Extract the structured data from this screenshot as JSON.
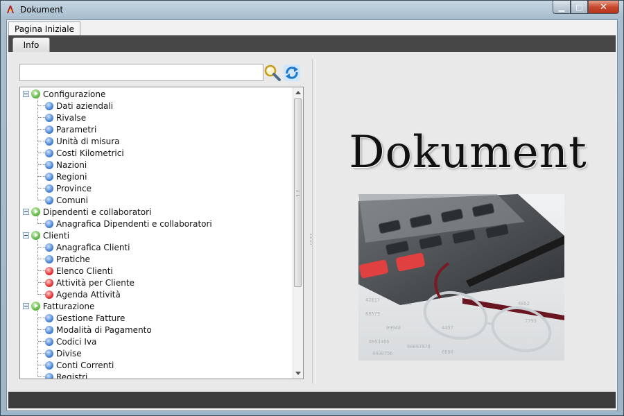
{
  "window": {
    "title": "Dokument",
    "buttons": {
      "minimize": "▁",
      "maximize": "□",
      "close": "✕"
    }
  },
  "tabs": {
    "top_tab": "Pagina Iniziale",
    "sub_tab": "Info"
  },
  "search": {
    "value": "",
    "placeholder": ""
  },
  "tree": {
    "groups": [
      {
        "label": "Configurazione",
        "items": [
          {
            "label": "Dati aziendali",
            "status": "blue"
          },
          {
            "label": "Rivalse",
            "status": "blue"
          },
          {
            "label": "Parametri",
            "status": "blue"
          },
          {
            "label": "Unità di misura",
            "status": "blue"
          },
          {
            "label": "Costi Kilometrici",
            "status": "blue"
          },
          {
            "label": "Nazioni",
            "status": "blue"
          },
          {
            "label": "Regioni",
            "status": "blue"
          },
          {
            "label": "Province",
            "status": "blue"
          },
          {
            "label": "Comuni",
            "status": "blue"
          }
        ]
      },
      {
        "label": "Dipendenti e collaboratori",
        "items": [
          {
            "label": "Anagrafica Dipendenti e collaboratori",
            "status": "blue"
          }
        ]
      },
      {
        "label": "Clienti",
        "items": [
          {
            "label": "Anagrafica Clienti",
            "status": "blue"
          },
          {
            "label": "Pratiche",
            "status": "blue"
          },
          {
            "label": "Elenco Clienti",
            "status": "red"
          },
          {
            "label": "Attività per Cliente",
            "status": "red"
          },
          {
            "label": "Agenda Attività",
            "status": "red"
          }
        ]
      },
      {
        "label": "Fatturazione",
        "items": [
          {
            "label": "Gestione Fatture",
            "status": "blue"
          },
          {
            "label": "Modalità di Pagamento",
            "status": "blue"
          },
          {
            "label": "Codici Iva",
            "status": "blue"
          },
          {
            "label": "Divise",
            "status": "blue"
          },
          {
            "label": "Conti Correnti",
            "status": "blue"
          },
          {
            "label": "Registri",
            "status": "blue"
          }
        ]
      }
    ]
  },
  "branding": {
    "title": "Dokument"
  },
  "colors": {
    "status_blue": "#4b86d6",
    "status_red": "#e23333",
    "group_green": "#55b23a",
    "dark_bar": "#474747"
  },
  "icons": {
    "search": "search-icon",
    "refresh": "refresh-icon",
    "group": "play-icon",
    "item": "status-dot-icon"
  }
}
